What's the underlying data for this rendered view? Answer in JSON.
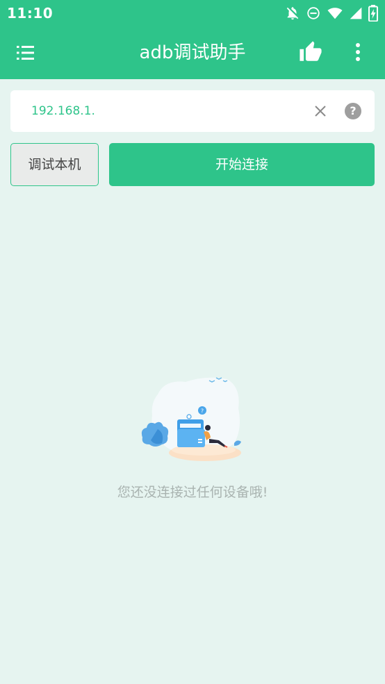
{
  "status_bar": {
    "time": "11:10",
    "icons": [
      "bell-off-icon",
      "do-not-disturb-icon",
      "wifi-icon",
      "cell-signal-icon",
      "battery-charging-icon"
    ]
  },
  "toolbar": {
    "title": "adb调试助手",
    "menu_icon": "menu-list-icon",
    "like_icon": "thumbs-up-icon",
    "more_icon": "more-vert-icon"
  },
  "ip_field": {
    "value": "192.168.1.",
    "clear_icon": "close-icon",
    "help_icon": "help-icon",
    "help_glyph": "?"
  },
  "buttons": {
    "debug_local": "调试本机",
    "start_connect": "开始连接"
  },
  "empty_state": {
    "message": "您还没连接过任何设备哦!",
    "illustration": "empty-folder-illustration"
  },
  "colors": {
    "primary": "#2ec48a",
    "background": "#e6f4f0",
    "card": "#ffffff",
    "muted_text": "#a9b3b0"
  }
}
